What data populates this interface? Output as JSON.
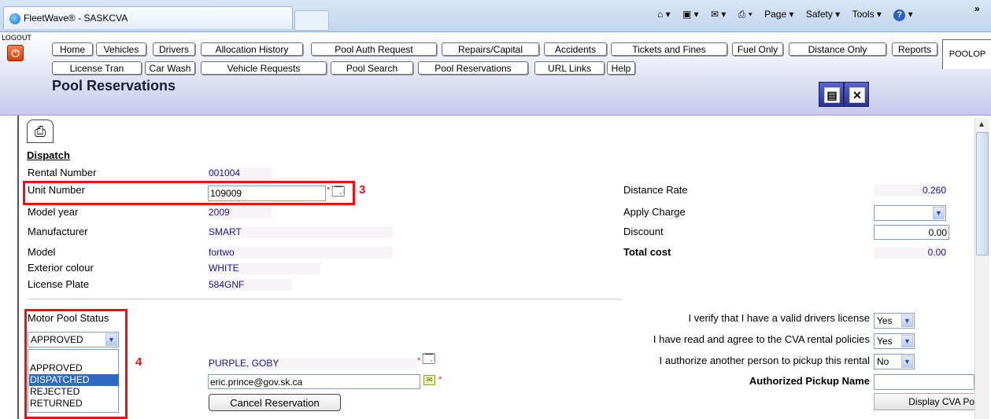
{
  "browser": {
    "tab_title": "FleetWave® - SASKCVA",
    "toolbar": {
      "page": "Page ▾",
      "safety": "Safety ▾",
      "tools": "Tools ▾",
      "help_arrow": "▾"
    },
    "chevron": "»"
  },
  "header": {
    "logout_label": "LOGOUT",
    "page_title": "Pool Reservations",
    "poolop_tab": "POOLOP",
    "nav_row1": [
      "Home",
      "Vehicles",
      "Drivers",
      "Allocation History",
      "Pool Auth Request",
      "Repairs/Capital",
      "Accidents",
      "Tickets and Fines",
      "Fuel Only",
      "Distance Only",
      "Reports"
    ],
    "nav_row2": [
      "License Tran",
      "Car Wash",
      "Vehicle Requests",
      "Pool Search",
      "Pool Reservations",
      "URL Links",
      "Help"
    ]
  },
  "dispatch": {
    "section_title": "Dispatch",
    "rental_number_label": "Rental Number",
    "rental_number": "001004",
    "unit_number_label": "Unit Number",
    "unit_number": "109009",
    "model_year_label": "Model year",
    "model_year": "2009",
    "manufacturer_label": "Manufacturer",
    "manufacturer": "SMART",
    "model_label": "Model",
    "model": "fortwo",
    "exterior_colour_label": "Exterior colour",
    "exterior_colour": "WHITE",
    "license_plate_label": "License Plate",
    "license_plate": "584GNF"
  },
  "charges": {
    "distance_rate_label": "Distance Rate",
    "distance_rate": "0.260",
    "apply_charge_label": "Apply Charge",
    "apply_charge": "",
    "discount_label": "Discount",
    "discount": "0.00",
    "total_cost_label": "Total cost",
    "total_cost": "0.00"
  },
  "status": {
    "label": "Motor Pool Status",
    "selected": "APPROVED",
    "options": [
      "APPROVED",
      "DISPATCHED",
      "REJECTED",
      "RETURNED"
    ],
    "highlighted_option": "DISPATCHED"
  },
  "driver": {
    "name": "PURPLE, GOBY",
    "email": "eric.prince@gov.sk.ca",
    "cancel_button": "Cancel Reservation"
  },
  "verifications": {
    "valid_license_label": "I verify that I have a valid drivers license",
    "valid_license": "Yes",
    "policies_label": "I have read and agree to the CVA rental policies",
    "policies": "Yes",
    "authorize_label": "I authorize another person to pickup this rental",
    "authorize": "No",
    "pickup_name_label": "Authorized Pickup Name",
    "pickup_name": "",
    "display_button": "Display CVA Po"
  },
  "annotations": {
    "marker_3": "3",
    "marker_4": "4"
  },
  "colors": {
    "annotation_red": "#ee1111",
    "header_blue": "#c6c9ec",
    "highlight": "#316ac5"
  }
}
